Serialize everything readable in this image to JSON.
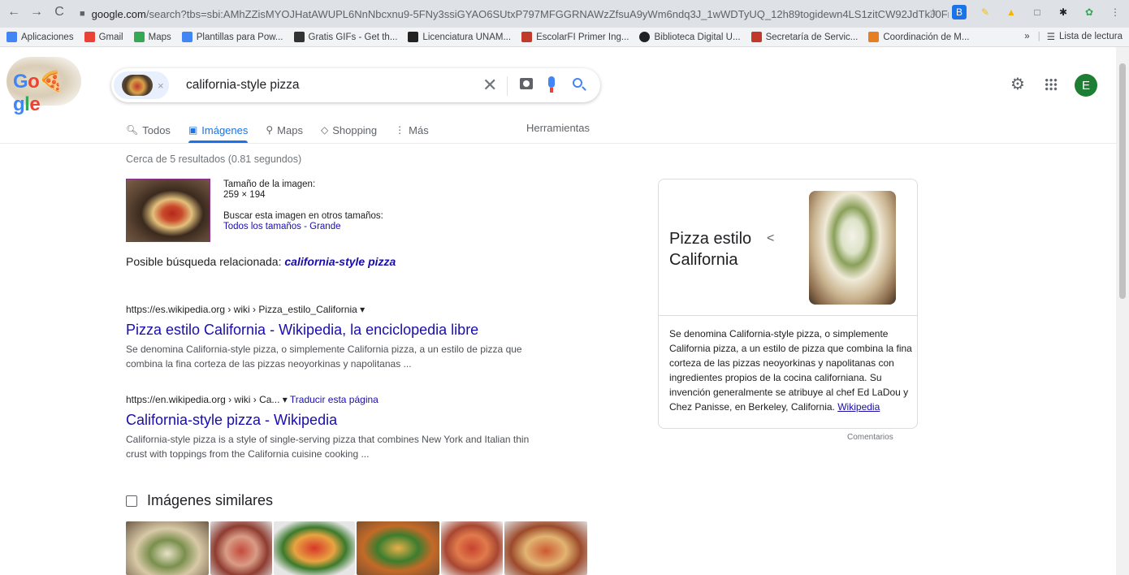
{
  "browser": {
    "url_host": "google.com",
    "url_rest": "/search?tbs=sbi:AMhZZisMYOJHatAWUPL6NnNbcxnu9-5FNy3ssiGYAO6SUtxP797MFGGRNAWzZfsuA9yWm6ndq3J_1wWDTyUQ_12h89togidewn4LS1zitCW92JdTkJ0FmselUcbgrVa...",
    "bookmarks": [
      {
        "label": "Aplicaciones",
        "color": "#4285f4"
      },
      {
        "label": "Gmail",
        "color": "#ea4335"
      },
      {
        "label": "Maps",
        "color": "#34a853"
      },
      {
        "label": "Plantillas para Pow...",
        "color": "#4285f4"
      },
      {
        "label": "Gratis GIFs - Get th...",
        "color": "#333333"
      },
      {
        "label": "Licenciatura UNAM...",
        "color": "#222222"
      },
      {
        "label": "EscolarFI Primer Ing...",
        "color": "#c0392b"
      },
      {
        "label": "Biblioteca Digital U...",
        "color": "#202124"
      },
      {
        "label": "Secretaría de Servic...",
        "color": "#c0392b"
      },
      {
        "label": "Coordinación de M...",
        "color": "#e67e22"
      }
    ],
    "reading_list": "Lista de lectura"
  },
  "search": {
    "query": "california-style pizza",
    "avatar_initial": "E"
  },
  "tabs": [
    {
      "label": "Todos",
      "icon": "🔍︎"
    },
    {
      "label": "Imágenes",
      "icon": "▣"
    },
    {
      "label": "Maps",
      "icon": "⚲"
    },
    {
      "label": "Shopping",
      "icon": "◇"
    },
    {
      "label": "Más",
      "icon": "⋮"
    }
  ],
  "tools_label": "Herramientas",
  "stats": "Cerca de 5 resultados (0.81 segundos)",
  "image_info": {
    "size_label": "Tamaño de la imagen:",
    "size_value": "259 × 194",
    "other_sizes": "Buscar esta imagen en otros tamaños:",
    "all_sizes": "Todos los tamaños",
    "separator": " - ",
    "large": "Grande"
  },
  "related": {
    "label": "Posible búsqueda relacionada: ",
    "query": "california-style pizza"
  },
  "results": [
    {
      "url": "https://es.wikipedia.org › wiki › Pizza_estilo_California ▾",
      "translate": "",
      "title": "Pizza estilo California - Wikipedia, la enciclopedia libre",
      "snippet": "Se denomina California-style pizza, o simplemente California pizza, a un estilo de pizza que combina la fina corteza de las pizzas neoyorkinas y napolitanas ..."
    },
    {
      "url": "https://en.wikipedia.org › wiki › Ca... ▾",
      "translate": "Traducir esta página",
      "title": "California-style pizza - Wikipedia",
      "snippet": "California-style pizza is a style of single-serving pizza that combines New York and Italian thin crust with toppings from the California cuisine cooking ..."
    }
  ],
  "similar_title": "Imágenes similares",
  "knowledge_panel": {
    "title": "Pizza estilo California",
    "description": "Se denomina California-style pizza, o simplemente California pizza, a un estilo de pizza que combina la fina corteza de las pizzas neoyorkinas y napolitanas con ingredientes propios de la cocina californiana. Su invención generalmente se atribuye al chef Ed LaDou y Chez Panisse, en Berkeley, California.",
    "source": "Wikipedia"
  },
  "feedback": "Comentarios"
}
